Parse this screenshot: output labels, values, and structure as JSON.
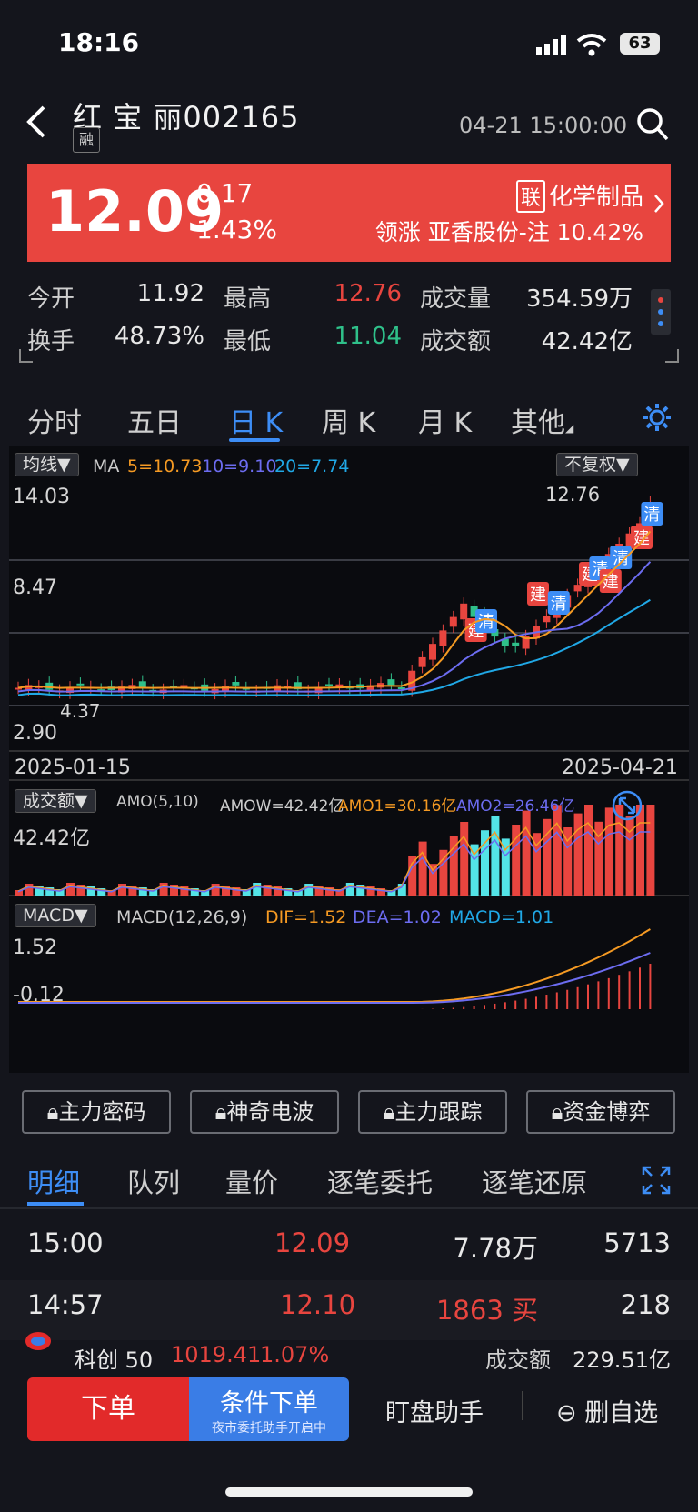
{
  "status": {
    "time": "18:16",
    "battery": "63"
  },
  "header": {
    "name": "红 宝 丽",
    "code": "002165",
    "tag": "融",
    "datetime": "04-21 15:00:00"
  },
  "quote": {
    "price": "12.09",
    "change": "0.17",
    "change_pct": "1.43%",
    "industry_tag": "联",
    "industry": "化学制品",
    "leader": "领涨 亚香股份-注 10.42%"
  },
  "stats": {
    "open_label": "今开",
    "open": "11.92",
    "high_label": "最高",
    "high": "12.76",
    "volume_label": "成交量",
    "volume": "354.59万",
    "turnover_label": "换手",
    "turnover": "48.73%",
    "low_label": "最低",
    "low": "11.04",
    "amount_label": "成交额",
    "amount": "42.42亿"
  },
  "tabs": [
    "分时",
    "五日",
    "日 K",
    "周 K",
    "月 K",
    "其他"
  ],
  "kline": {
    "ma_pill": "均线▼",
    "ma_label": "MA",
    "ma5": "5=10.73",
    "ma10": "10=9.10",
    "ma20": "20=7.74",
    "adjust": "不复权▼",
    "y_top": "14.03",
    "y_mid": "8.47",
    "y_bottom": "2.90",
    "low_mark": "4.37",
    "high_mark": "12.76",
    "date_start": "2025-01-15",
    "date_end": "2025-04-21",
    "sig_clear": "清",
    "sig_build": "建"
  },
  "amount_panel": {
    "pill": "成交额▼",
    "label": "AMO(5,10)",
    "amow": "AMOW=42.42亿",
    "amo1": "AMO1=30.16亿",
    "amo2": "AMO2=26.46亿",
    "y_top": "42.42亿"
  },
  "macd_panel": {
    "pill": "MACD▼",
    "label": "MACD(12,26,9)",
    "dif": "DIF=1.52",
    "dea": "DEA=1.02",
    "macd": "MACD=1.01",
    "y_top": "1.52",
    "y_bottom": "-0.12"
  },
  "func_buttons": [
    "主力密码",
    "神奇电波",
    "主力跟踪",
    "资金博弈"
  ],
  "detail_tabs": [
    "明细",
    "队列",
    "量价",
    "逐笔委托",
    "逐笔还原"
  ],
  "detail_rows": [
    {
      "time": "15:00",
      "price": "12.09",
      "vol": "7.78万",
      "count": "5713"
    },
    {
      "time": "14:57",
      "price": "12.10",
      "vol": "1863 买",
      "count": "218"
    }
  ],
  "ticker": {
    "name": "科创 50",
    "value": "1019.41",
    "pct": "1.07%",
    "amount_label": "成交额",
    "amount": "229.51亿"
  },
  "bottom": {
    "order": "下单",
    "cond": "条件下单",
    "cond_sub": "夜市委托助手开启中",
    "watch": "盯盘助手",
    "remove": "删自选"
  },
  "colors": {
    "up": "#e8453f",
    "down": "#2fc08a",
    "accent": "#3d8df5",
    "ma5": "#f59a23",
    "ma10": "#6c6cf0",
    "ma20": "#20a8e6"
  }
}
